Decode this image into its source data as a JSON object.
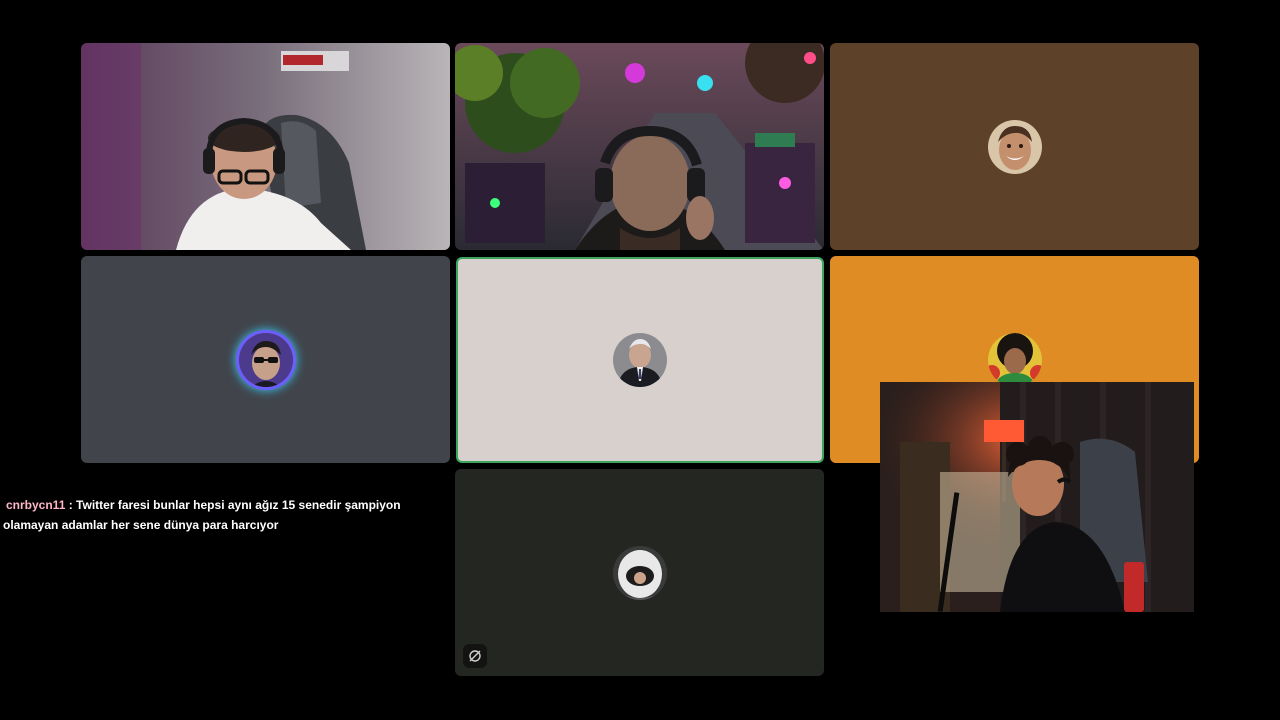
{
  "participants": [
    {
      "id": "p1",
      "kind": "video",
      "scene": "person-glasses-chair"
    },
    {
      "id": "p2",
      "kind": "video",
      "scene": "game-street-with-person"
    },
    {
      "id": "p3",
      "kind": "avatar",
      "bg": "#5e4129",
      "avatar": "smiling-man"
    },
    {
      "id": "p4",
      "kind": "avatar",
      "bg": "#41444b",
      "avatar": "sunglasses-man"
    },
    {
      "id": "p5",
      "kind": "avatar",
      "bg": "#d8d0cd",
      "avatar": "suit-man",
      "speaking": true
    },
    {
      "id": "p6",
      "kind": "avatar",
      "bg": "#e08c24",
      "avatar": "curly-hair-man"
    },
    {
      "id": "p7",
      "kind": "avatar",
      "bg": "#232621",
      "avatar": "helmet",
      "camera_off": true
    }
  ],
  "chat": {
    "username": "cnrbycn11",
    "separator": " : ",
    "message": "Twitter faresi bunlar hepsi aynı ağız 15 senedir şampiyon olamayan adamlar her sene dünya para harcıyor"
  },
  "colors": {
    "background": "#000000",
    "speaking_border": "#3aa55c",
    "chat_username": "#ffb6c8"
  }
}
